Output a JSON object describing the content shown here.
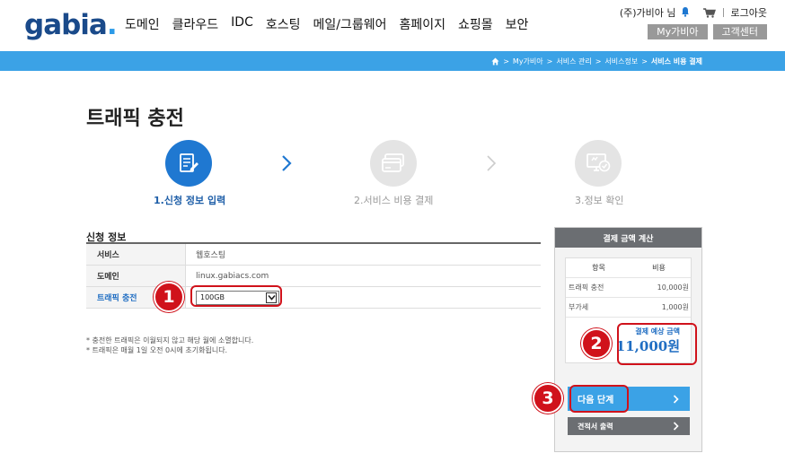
{
  "header": {
    "logo": "gabia",
    "logo_dot": ".",
    "nav": [
      "도메인",
      "클라우드",
      "IDC",
      "호스팅",
      "메일/그룹웨어",
      "홈페이지",
      "쇼핑몰",
      "보안"
    ],
    "user": "(주)가비아 님",
    "logout": "로그아웃",
    "my_button": "My가비아",
    "support_button": "고객센터"
  },
  "breadcrumb": {
    "items": [
      "My가비아",
      "서비스 관리",
      "서비스정보"
    ],
    "current": "서비스 비용 결제"
  },
  "page": {
    "title": "트래픽 충전"
  },
  "steps": [
    {
      "label": "1.신청 정보 입력",
      "active": true,
      "icon": "form-edit-icon"
    },
    {
      "label": "2.서비스 비용 결제",
      "active": false,
      "icon": "credit-card-icon"
    },
    {
      "label": "3.정보 확인",
      "active": false,
      "icon": "monitor-check-icon"
    }
  ],
  "form": {
    "title": "신청 정보",
    "rows": [
      {
        "label": "서비스",
        "value": "웹호스팅"
      },
      {
        "label": "도메인",
        "value": "linux.gabiacs.com"
      },
      {
        "label": "트래픽 충전",
        "value": "100GB"
      }
    ],
    "notes": [
      "* 충전한 트래픽은 이월되지 않고 해당 월에 소멸합니다.",
      "* 트래픽은 매월 1일 오전 0시에 초기화됩니다."
    ]
  },
  "sidebar": {
    "title": "결제 금액 계산",
    "col_item": "항목",
    "col_cost": "비용",
    "items": [
      {
        "name": "트래픽 충전",
        "cost": "10,000원"
      },
      {
        "name": "부가세",
        "cost": "1,000원"
      }
    ],
    "total_label": "결제 예상 금액",
    "total_amount": "11,000원",
    "next_button": "다음 단계",
    "estimate_button": "견적서 출력"
  },
  "annotations": [
    "1",
    "2",
    "3"
  ],
  "colors": {
    "brand_blue": "#3ba2e6",
    "active_step": "#1f78d1",
    "highlight_red": "#d0121b"
  }
}
